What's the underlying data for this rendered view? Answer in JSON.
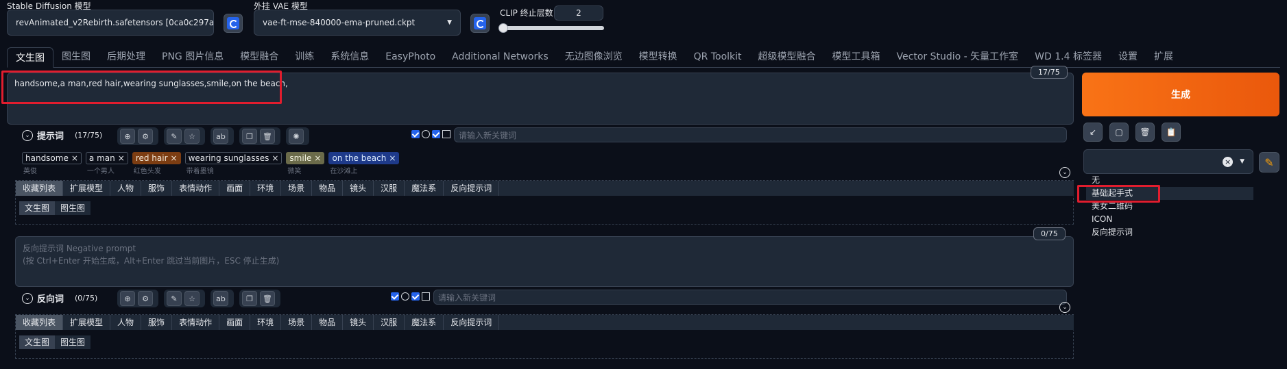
{
  "top": {
    "sd_model_label": "Stable Diffusion 模型",
    "sd_model_value": "revAnimated_v2Rebirth.safetensors [0ca0c297a",
    "vae_label": "外挂 VAE 模型",
    "vae_value": "vae-ft-mse-840000-ema-pruned.ckpt",
    "clip_label": "CLIP 终止层数",
    "clip_value": "2",
    "clip_slider_fraction": 0.0
  },
  "tabs": [
    "文生图",
    "图生图",
    "后期处理",
    "PNG 图片信息",
    "模型融合",
    "训练",
    "系统信息",
    "EasyPhoto",
    "Additional Networks",
    "无边图像浏览",
    "模型转换",
    "QR Toolkit",
    "超级模型融合",
    "模型工具箱",
    "Vector Studio - 矢量工作室",
    "WD 1.4 标签器",
    "设置",
    "扩展"
  ],
  "prompt": {
    "text": "handsome,a man,red hair,wearing sunglasses,smile,on the beach,",
    "counter": "17/75",
    "label": "提示词",
    "count": "(17/75)",
    "keyword_placeholder": "请输入新关键词",
    "chips": [
      {
        "text": "handsome",
        "sub": "英俊",
        "bg": "",
        "color": ""
      },
      {
        "text": "a man",
        "sub": "一个男人",
        "bg": "",
        "color": ""
      },
      {
        "text": "red hair",
        "sub": "红色头发",
        "bg": "#7c3d12",
        "color": "#f3e8d8"
      },
      {
        "text": "wearing sunglasses",
        "sub": "带着墨镜",
        "bg": "",
        "color": ""
      },
      {
        "text": "smile",
        "sub": "微笑",
        "bg": "#6b6b4a",
        "color": "#f3f3e0"
      },
      {
        "text": "on the beach",
        "sub": "在沙滩上",
        "bg": "#1e3a8a",
        "color": "#dbeafe"
      }
    ]
  },
  "categories": [
    "收藏列表",
    "扩展模型",
    "人物",
    "服饰",
    "表情动作",
    "画面",
    "环境",
    "场景",
    "物品",
    "镜头",
    "汉服",
    "魔法系",
    "反向提示词"
  ],
  "subcats": [
    "文生图",
    "图生图"
  ],
  "negative": {
    "placeholder_line1": "反向提示词 Negative prompt",
    "placeholder_line2": "(按 Ctrl+Enter 开始生成，Alt+Enter 跳过当前图片，ESC 停止生成)",
    "counter": "0/75",
    "label": "反向词",
    "count": "(0/75)",
    "keyword_placeholder": "请输入新关键词"
  },
  "right": {
    "generate_label": "生成",
    "style_options": [
      "无",
      "基础起手式",
      "美女二维码",
      "ICON",
      "反向提示词"
    ],
    "accent": "#ea580c"
  }
}
